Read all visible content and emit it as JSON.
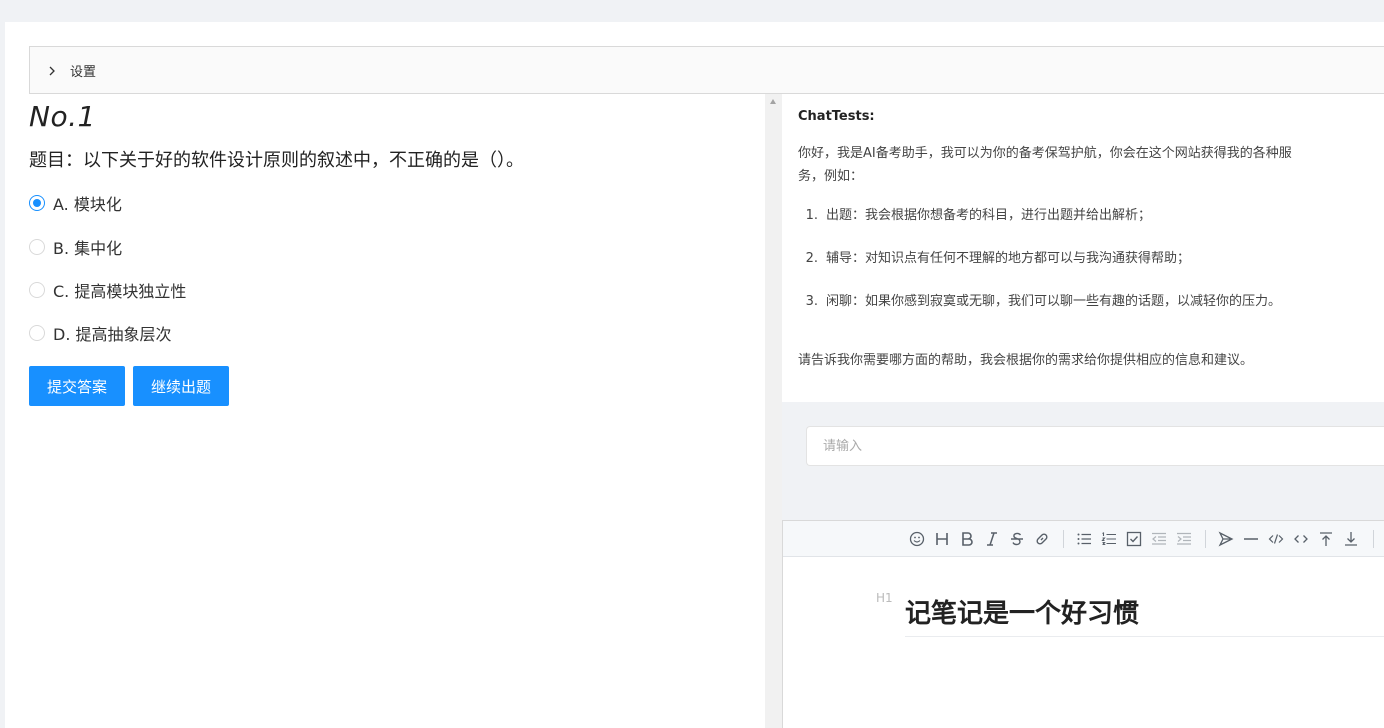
{
  "settings": {
    "label": "设置"
  },
  "question": {
    "number": "No.1",
    "text": "题目：以下关于好的软件设计原则的叙述中，不正确的是（）。",
    "options": [
      {
        "label": "A. 模块化",
        "selected": true
      },
      {
        "label": "B. 集中化",
        "selected": false
      },
      {
        "label": "C. 提高模块独立性",
        "selected": false
      },
      {
        "label": "D. 提高抽象层次",
        "selected": false
      }
    ],
    "submit_label": "提交答案",
    "next_label": "继续出题"
  },
  "chat": {
    "title": "ChatTests:",
    "intro": "你好，我是AI备考助手，我可以为你的备考保驾护航，你会在这个网站获得我的各种服务，例如：",
    "items": [
      {
        "num": "1.",
        "text": "出题：我会根据你想备考的科目，进行出题并给出解析；"
      },
      {
        "num": "2.",
        "text": "辅导：对知识点有任何不理解的地方都可以与我沟通获得帮助；"
      },
      {
        "num": "3.",
        "text": "闲聊：如果你感到寂寞或无聊，我们可以聊一些有趣的话题，以减轻你的压力。"
      }
    ],
    "outro": "请告诉我你需要哪方面的帮助，我会根据你的需求给你提供相应的信息和建议。",
    "input_placeholder": "请输入"
  },
  "editor": {
    "heading_marker": "H1",
    "heading": "记笔记是一个好习惯",
    "toolbar_icons": [
      "emoji-icon",
      "heading-icon",
      "bold-icon",
      "italic-icon",
      "strike-icon",
      "link-icon",
      "bullet-list-icon",
      "ordered-list-icon",
      "checklist-icon",
      "outdent-icon",
      "indent-icon",
      "quote-icon",
      "hr-icon",
      "code-icon",
      "inline-code-icon",
      "insert-before-icon",
      "insert-after-icon"
    ]
  },
  "colors": {
    "primary": "#1890ff",
    "background": "#f0f2f5"
  }
}
